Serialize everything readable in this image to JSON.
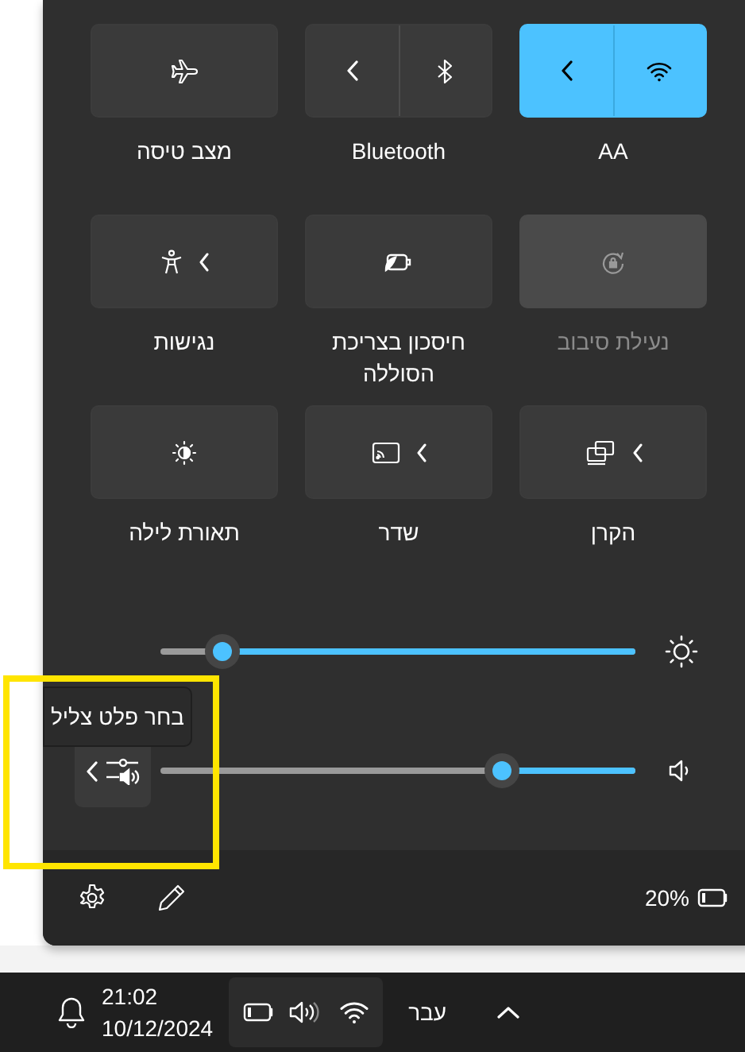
{
  "tiles": [
    {
      "label": "AA",
      "kind": "split",
      "on": true,
      "disabled": false
    },
    {
      "label": "Bluetooth",
      "kind": "split",
      "on": false,
      "disabled": false
    },
    {
      "label": "מצב טיסה",
      "kind": "plain",
      "on": false,
      "disabled": false
    },
    {
      "label": "נעילת סיבוב",
      "kind": "plain",
      "on": false,
      "disabled": true
    },
    {
      "label": "חיסכון בצריכת הסוללה",
      "kind": "plain",
      "on": false,
      "disabled": false
    },
    {
      "label": "נגישות",
      "kind": "arrow",
      "on": false,
      "disabled": false
    },
    {
      "label": "הקרן",
      "kind": "arrow",
      "on": false,
      "disabled": false
    },
    {
      "label": "שדר",
      "kind": "arrow",
      "on": false,
      "disabled": false
    },
    {
      "label": "תאורת לילה",
      "kind": "plain",
      "on": false,
      "disabled": false
    }
  ],
  "sliders": [
    {
      "kind": "brightness",
      "level": 0.87
    },
    {
      "kind": "volume",
      "level": 0.28
    }
  ],
  "tooltip": {
    "text": "בחר פלט צליל"
  },
  "footer": {
    "battery": "20%"
  },
  "taskbar": {
    "time": "21:02",
    "date": "10/12/2024",
    "language": "עבר"
  }
}
